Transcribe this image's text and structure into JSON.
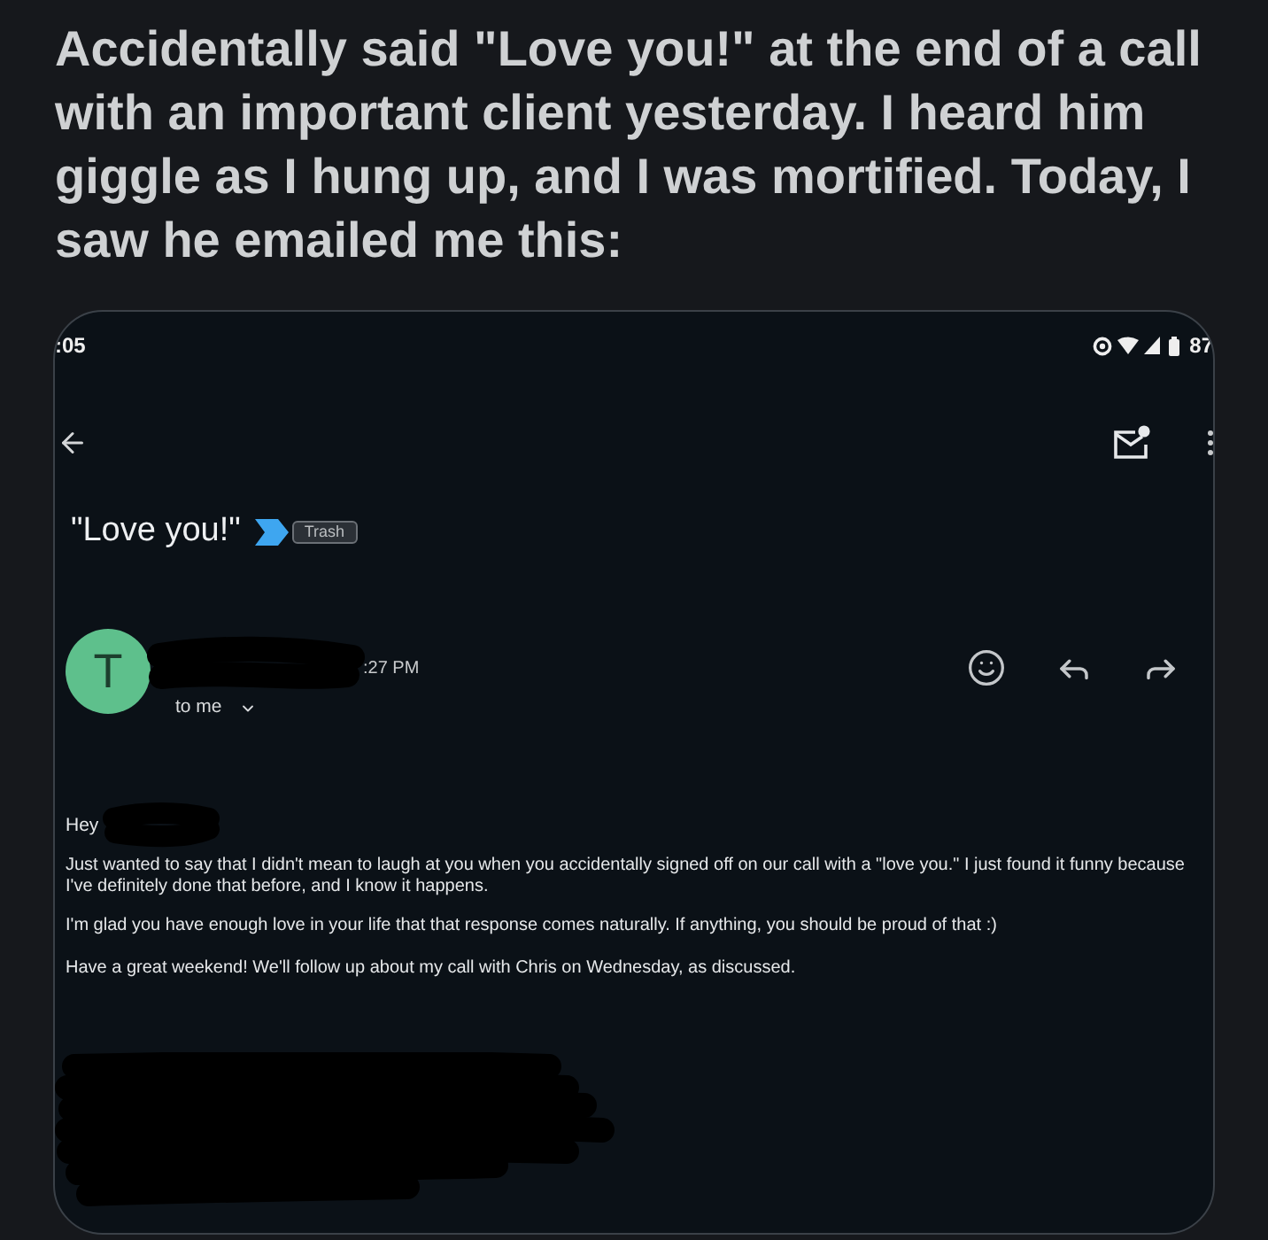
{
  "post": {
    "caption": "Accidentally said \"Love you!\" at the end of a call with an important client yesterday. I heard him giggle as I hung up, and I was mortified. Today, I saw he emailed me this:"
  },
  "phone_screenshot": {
    "status_bar": {
      "time": ":05",
      "battery": "87"
    },
    "email": {
      "subject": "\"Love you!\"",
      "important": true,
      "label": "Trash",
      "sender": {
        "initial": "T",
        "name_redacted": true,
        "time": ":27 PM",
        "recipient": "to me"
      },
      "body": {
        "greeting": "Hey",
        "greeting_name_redacted": true,
        "paragraphs": [
          "Just wanted to say that I didn't mean to laugh at you when you accidentally signed off on our call with a \"love you.\" I just found it funny because I've definitely done that before, and I know it happens.",
          "I'm glad you have enough love in your life that that response comes naturally. If anything, you should be proud of that :)",
          "Have a great weekend! We'll follow up about my call with Chris on Wednesday, as discussed."
        ],
        "signature_redacted": true
      }
    }
  }
}
